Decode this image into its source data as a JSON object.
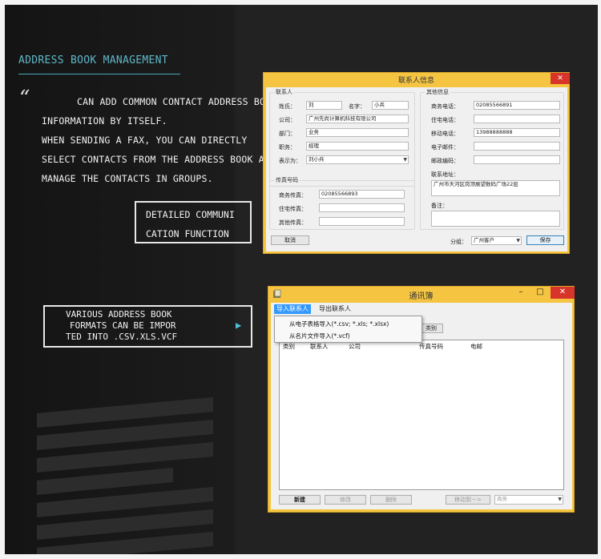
{
  "left": {
    "section_title": "ADDRESS BOOK MANAGEMENT",
    "quote": "“",
    "desc_lines": [
      "CAN ADD COMMON CONTACT ADDRESS BOOK",
      "INFORMATION BY ITSELF.",
      "WHEN SENDING A FAX, YOU CAN DIRECTLY",
      "SELECT CONTACTS FROM THE ADDRESS BOOK AND",
      "MANAGE THE CONTACTS IN GROUPS."
    ],
    "detail_box": [
      "DETAILED COMMUNI",
      "CATION FUNCTION"
    ],
    "formats_box": [
      "VARIOUS ADDRESS BOOK",
      "FORMATS CAN BE IMPOR",
      "TED INTO .CSV.XLS.VCF"
    ],
    "arrow": "▶"
  },
  "contact_window": {
    "title": "联系人信息",
    "close": "✕",
    "group_contact": "联系人",
    "surname_label": "姓氏：",
    "surname_value": "刘",
    "name_label": "名字：",
    "name_value": "小兵",
    "company_label": "公司：",
    "company_value": "广州先尚计算机科技有限公司",
    "dept_label": "部门：",
    "dept_value": "业务",
    "position_label": "职务：",
    "position_value": "经理",
    "display_label": "表示为：",
    "display_value": "刘小兵",
    "group_fax": "传真号码",
    "biz_fax_label": "商务传真：",
    "biz_fax_value": "02085566893",
    "home_fax_label": "住宅传真：",
    "home_fax_value": "",
    "other_fax_label": "其他传真：",
    "other_fax_value": "",
    "group_other": "其他信息",
    "biz_phone_label": "商务电话：",
    "biz_phone_value": "02085566891",
    "home_phone_label": "住宅电话：",
    "home_phone_value": "",
    "mobile_label": "移动电话：",
    "mobile_value": "13988888888",
    "email_label": "电子邮件：",
    "email_value": "",
    "zip_label": "邮政编码：",
    "zip_value": "",
    "address_label": "联系地址：",
    "address_value": "广州市天河区岗顶展望数码广场22层",
    "note_label": "备注：",
    "note_value": "",
    "cancel_btn": "取消",
    "group_select_label": "分组：",
    "group_select_value": "广州客户",
    "save_btn": "保存"
  },
  "addressbook_window": {
    "title": "通讯簿",
    "minimize": "–",
    "maximize": "□",
    "close": "✕",
    "menu": [
      "导入联系人",
      "导出联系人"
    ],
    "dropdown": [
      "从电子表格导入(*.csv; *.xls; *.xlsx)",
      "从名片文件导入(*.vcf)"
    ],
    "hidden_btn_fragment": "类别",
    "columns": [
      "类别",
      "联系人",
      "公司",
      "传真号码",
      "电邮"
    ],
    "new_btn": "新建",
    "edit_btn": "修改",
    "delete_btn": "删除",
    "move_btn": "移动到－>",
    "move_target": "商务"
  }
}
